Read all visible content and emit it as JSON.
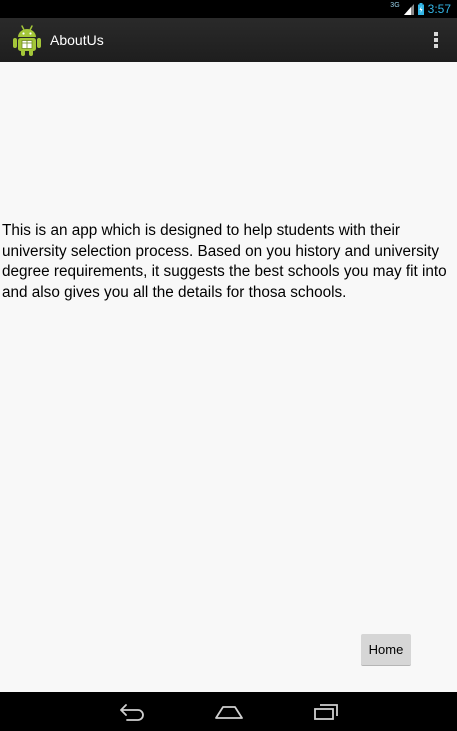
{
  "status_bar": {
    "network": "3G",
    "time": "3:57"
  },
  "action_bar": {
    "title": "AboutUs",
    "app_icon": "android-robot-icon",
    "menu_icon": "overflow-menu-icon"
  },
  "content": {
    "about_text": "This is an app which is designed to help students with their university selection process. Based on you history and university degree requirements, it suggests the best schools you may fit into and also gives you all the details for thosa schools.",
    "home_button_label": "Home"
  },
  "nav_bar": {
    "back_icon": "back-icon",
    "home_icon": "home-icon",
    "recents_icon": "recents-icon"
  },
  "colors": {
    "status_clock": "#33b5e5",
    "action_bar_bg": "#222222",
    "content_bg": "#f8f8f8",
    "button_bg": "#d6d6d6",
    "android_green": "#a4c639"
  }
}
